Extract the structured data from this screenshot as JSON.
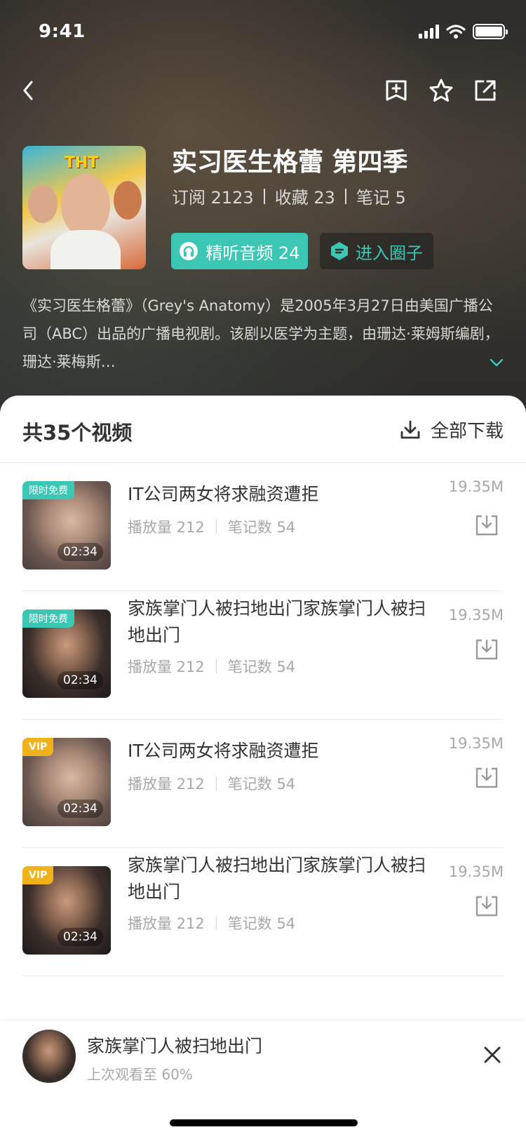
{
  "status_bar": {
    "time": "9:41"
  },
  "nav": {
    "back_icon": "chevron-left-icon",
    "add_icon": "add-bookmark-icon",
    "star_icon": "star-icon",
    "share_icon": "share-icon"
  },
  "show": {
    "title": "实习医生格蕾 第四季",
    "stats": {
      "subscribe": "订阅 2123",
      "favorite": "收藏 23",
      "notes": "笔记 5"
    },
    "audio_button": "精听音频 24",
    "circle_button": "进入圈子",
    "description": "《实习医生格蕾》（Grey's Anatomy）是2005年3月27日由美国广播公司（ABC）出品的广播电视剧。该剧以医学为主题，由珊达·莱姆斯编剧，珊达·莱梅斯…",
    "cover_logo": "THT"
  },
  "list": {
    "count_title": "共35个视频",
    "download_all": "全部下载",
    "items": [
      {
        "title": "IT公司两女将求融资遭拒",
        "plays": "播放量 212",
        "notes": "笔记数 54",
        "size": "19.35M",
        "duration": "02:34",
        "badge": "限时免费"
      },
      {
        "title": "家族掌门人被扫地出门家族掌门人被扫地出门",
        "plays": "播放量 212",
        "notes": "笔记数 54",
        "size": "19.35M",
        "duration": "02:34",
        "badge": "限时免费"
      },
      {
        "title": "IT公司两女将求融资遭拒",
        "plays": "播放量 212",
        "notes": "笔记数 54",
        "size": "19.35M",
        "duration": "02:34",
        "badge": "VIP"
      },
      {
        "title": "家族掌门人被扫地出门家族掌门人被扫地出门",
        "plays": "播放量 212",
        "notes": "笔记数 54",
        "size": "19.35M",
        "duration": "02:34",
        "badge": "VIP"
      }
    ]
  },
  "now_playing": {
    "title": "家族掌门人被扫地出门",
    "progress": "上次观看至 60%"
  },
  "colors": {
    "accent": "#3cc7b4",
    "vip": "#f0b21b",
    "text": "#333333",
    "muted": "#a8a8a8"
  }
}
